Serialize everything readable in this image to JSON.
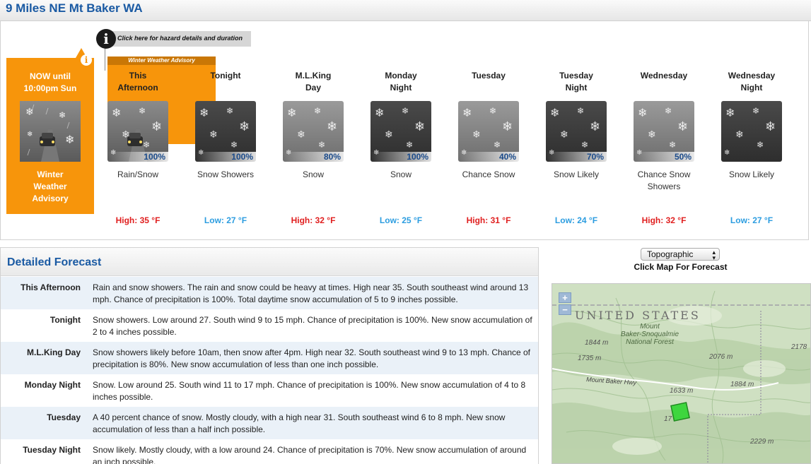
{
  "location_title": "9 Miles NE Mt Baker WA",
  "hazard_tip": "Click here for hazard details and duration",
  "now": {
    "title_line1": "NOW until",
    "title_line2": "10:00pm Sun",
    "label_line1": "Winter",
    "label_line2": "Weather",
    "label_line3": "Advisory"
  },
  "advisory_banner": "Winter Weather Advisory",
  "periods": [
    {
      "name1": "This",
      "name2": "Afternoon",
      "pop": "100%",
      "desc1": "Rain/Snow",
      "desc2": "",
      "temp": "High: 35 °F",
      "kind": "high"
    },
    {
      "name1": "Tonight",
      "name2": "",
      "pop": "100%",
      "desc1": "Snow Showers",
      "desc2": "",
      "temp": "Low: 27 °F",
      "kind": "low"
    },
    {
      "name1": "M.L.King",
      "name2": "Day",
      "pop": "80%",
      "desc1": "Snow",
      "desc2": "",
      "temp": "High: 32 °F",
      "kind": "high"
    },
    {
      "name1": "Monday",
      "name2": "Night",
      "pop": "100%",
      "desc1": "Snow",
      "desc2": "",
      "temp": "Low: 25 °F",
      "kind": "low"
    },
    {
      "name1": "Tuesday",
      "name2": "",
      "pop": "40%",
      "desc1": "Chance Snow",
      "desc2": "",
      "temp": "High: 31 °F",
      "kind": "high"
    },
    {
      "name1": "Tuesday",
      "name2": "Night",
      "pop": "70%",
      "desc1": "Snow Likely",
      "desc2": "",
      "temp": "Low: 24 °F",
      "kind": "low"
    },
    {
      "name1": "Wednesday",
      "name2": "",
      "pop": "50%",
      "desc1": "Chance Snow",
      "desc2": "Showers",
      "temp": "High: 32 °F",
      "kind": "high"
    },
    {
      "name1": "Wednesday",
      "name2": "Night",
      "pop": "",
      "desc1": "Snow Likely",
      "desc2": "",
      "temp": "Low: 27 °F",
      "kind": "low"
    }
  ],
  "detailed": {
    "heading": "Detailed Forecast",
    "rows": [
      {
        "label": "This Afternoon",
        "text": "Rain and snow showers. The rain and snow could be heavy at times. High near 35. South southeast wind around 13 mph. Chance of precipitation is 100%. Total daytime snow accumulation of 5 to 9 inches possible."
      },
      {
        "label": "Tonight",
        "text": "Snow showers. Low around 27. South wind 9 to 15 mph. Chance of precipitation is 100%. New snow accumulation of 2 to 4 inches possible."
      },
      {
        "label": "M.L.King Day",
        "text": "Snow showers likely before 10am, then snow after 4pm. High near 32. South southeast wind 9 to 13 mph. Chance of precipitation is 80%. New snow accumulation of less than one inch possible."
      },
      {
        "label": "Monday Night",
        "text": "Snow. Low around 25. South wind 11 to 17 mph. Chance of precipitation is 100%. New snow accumulation of 4 to 8 inches possible."
      },
      {
        "label": "Tuesday",
        "text": "A 40 percent chance of snow. Mostly cloudy, with a high near 31. South southeast wind 6 to 8 mph. New snow accumulation of less than a half inch possible."
      },
      {
        "label": "Tuesday Night",
        "text": "Snow likely. Mostly cloudy, with a low around 24. Chance of precipitation is 70%. New snow accumulation of around an inch possible."
      }
    ]
  },
  "map": {
    "layer_select": "Topographic",
    "caption": "Click Map For Forecast",
    "zoom_in": "+",
    "zoom_out": "−",
    "country_label": "UNITED STATES",
    "forest_line1": "Mount",
    "forest_line2": "Baker-Snoqualmie",
    "forest_line3": "National Forest",
    "road_label": "Mount Baker Hwy",
    "elevations": [
      "1844 m",
      "1735 m",
      "2076 m",
      "2178",
      "1884 m",
      "1633 m",
      "17",
      "2229 m"
    ]
  },
  "colors": {
    "advisory_orange": "#f7950b",
    "high_red": "#e01f1f",
    "low_blue": "#2c9de0",
    "title_blue": "#1a5aa3"
  }
}
